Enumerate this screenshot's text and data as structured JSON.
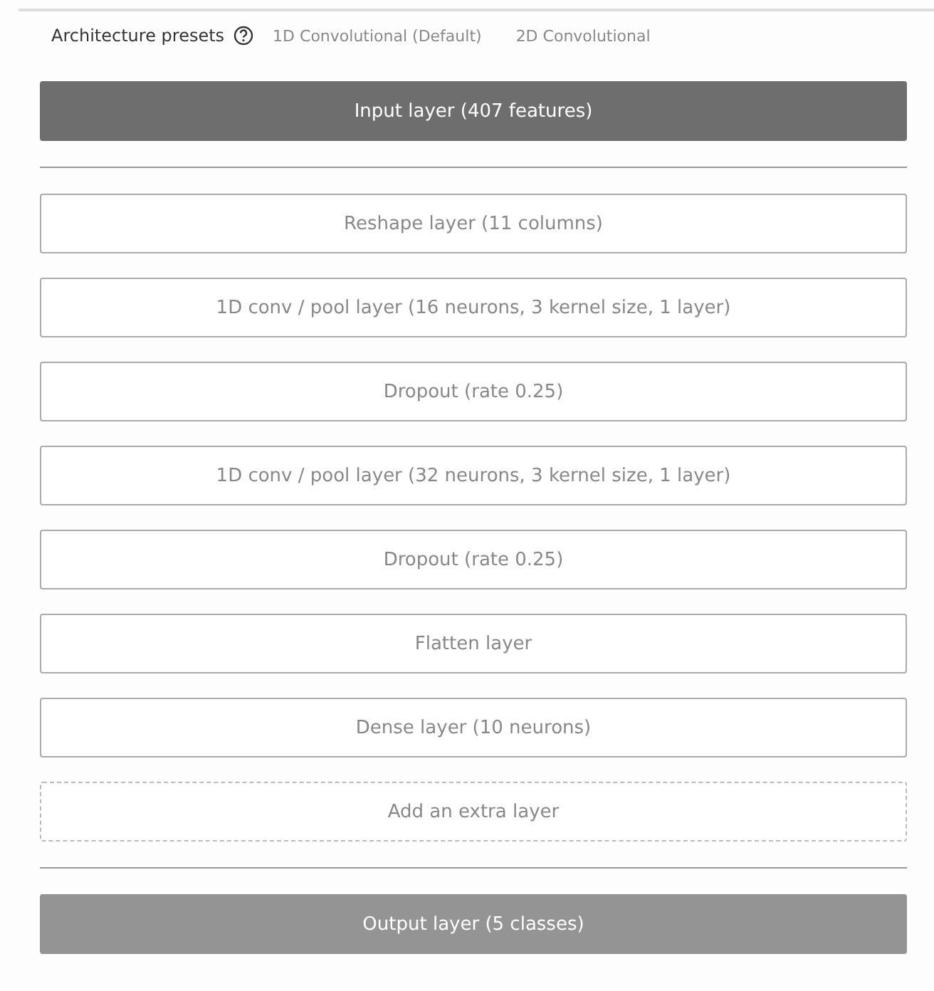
{
  "presets": {
    "label": "Architecture presets",
    "options": [
      {
        "label": "1D Convolutional (Default)",
        "selected": false
      },
      {
        "label": "2D Convolutional",
        "selected": false
      }
    ]
  },
  "layers": [
    {
      "kind": "input",
      "label": "Input layer (407 features)"
    },
    {
      "kind": "divider"
    },
    {
      "kind": "layer",
      "label": "Reshape layer (11 columns)"
    },
    {
      "kind": "layer",
      "label": "1D conv / pool layer (16 neurons, 3 kernel size, 1 layer)"
    },
    {
      "kind": "layer",
      "label": "Dropout (rate 0.25)"
    },
    {
      "kind": "layer",
      "label": "1D conv / pool layer (32 neurons, 3 kernel size, 1 layer)"
    },
    {
      "kind": "layer",
      "label": "Dropout (rate 0.25)"
    },
    {
      "kind": "layer",
      "label": "Flatten layer"
    },
    {
      "kind": "layer",
      "label": "Dense layer (10 neurons)"
    },
    {
      "kind": "add",
      "label": "Add an extra layer"
    },
    {
      "kind": "divider"
    },
    {
      "kind": "output",
      "label": "Output layer (5 classes)"
    }
  ]
}
